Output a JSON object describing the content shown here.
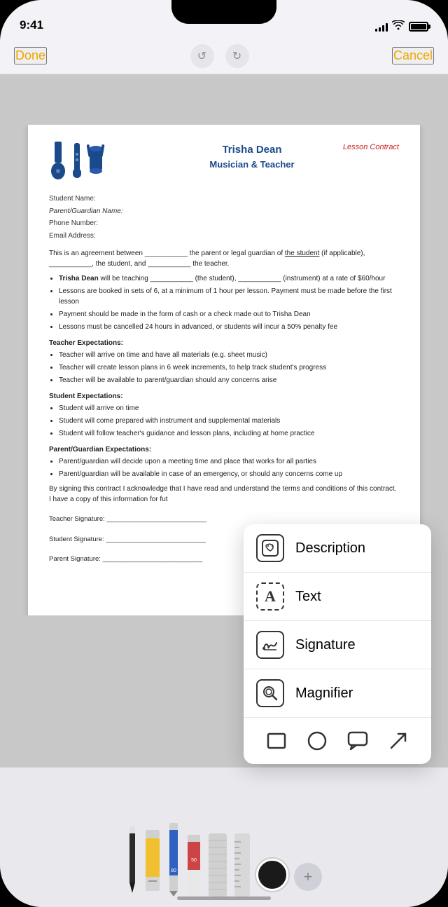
{
  "statusBar": {
    "time": "9:41",
    "signalBars": [
      3,
      5,
      7,
      10,
      12
    ],
    "battery": "full"
  },
  "navbar": {
    "done_label": "Done",
    "cancel_label": "Cancel",
    "undo_icon": "↺",
    "redo_icon": "↻"
  },
  "document": {
    "header": {
      "name": "Trisha Dean",
      "subtitle": "Musician & Teacher",
      "contract_label": "Lesson Contract"
    },
    "fields": [
      {
        "label": "Student Name:",
        "value": ""
      },
      {
        "label": "Parent/Guardian Name:",
        "value": "",
        "italic": true
      },
      {
        "label": "Phone Number:",
        "value": ""
      },
      {
        "label": "Email Address:",
        "value": ""
      }
    ],
    "body_text": "This is an agreement between ___________ the parent or legal guardian of the student (if applicable), ___________, the student, and ___________ the teacher.",
    "bullet_points": [
      "Trisha Dean will be teaching ___________ (the student), ___________ (instrument) at a rate of $60/hour",
      "Lessons are booked in sets of 6, at a minimum of 1 hour per lesson. Payment must be made before the first lesson",
      "Payment should be made in the form of cash or a check made out to Trisha Dean",
      "Lessons must be cancelled 24 hours in advanced, or students will incur a 50% penalty fee"
    ],
    "sections": [
      {
        "title": "Teacher Expectations:",
        "items": [
          "Teacher will arrive on time and have all materials (e.g. sheet music)",
          "Teacher will create lesson plans in 6 week increments, to help track student's progress",
          "Teacher will be available to parent/guardian should any concerns arise"
        ]
      },
      {
        "title": "Student Expectations:",
        "items": [
          "Student will arrive on time",
          "Student will come prepared with instrument and supplemental materials",
          "Student will follow teacher's guidance and lesson plans, including at home practice"
        ]
      },
      {
        "title": "Parent/Guardian Expectations:",
        "items": [
          "Parent/guardian will decide upon a meeting time and place that works for all parties",
          "Parent/guardian will be available in case of an emergency, or should any concerns come up"
        ]
      }
    ],
    "closing_text": "By signing this contract I acknowledge that I have read and understand the terms and conditions of this contract. I have a copy of this information for fut",
    "signatures": [
      {
        "label": "Teacher Signature:",
        "line": "___________________________"
      },
      {
        "label": "Student Signature:",
        "line": "___________________________"
      },
      {
        "label": "Parent Signature:",
        "line": "___________________________"
      }
    ]
  },
  "popup_menu": {
    "items": [
      {
        "id": "description",
        "label": "Description",
        "icon": "💬"
      },
      {
        "id": "text",
        "label": "Text",
        "icon": "A"
      },
      {
        "id": "signature",
        "label": "Signature",
        "icon": "✍"
      },
      {
        "id": "magnifier",
        "label": "Magnifier",
        "icon": "🔍"
      }
    ],
    "shapes": [
      {
        "id": "rectangle",
        "shape": "□"
      },
      {
        "id": "circle",
        "shape": "○"
      },
      {
        "id": "callout",
        "shape": "💬"
      },
      {
        "id": "arrow",
        "shape": "↗"
      }
    ]
  },
  "toolbar": {
    "color_value": "#1a1a1a",
    "plus_label": "+"
  }
}
